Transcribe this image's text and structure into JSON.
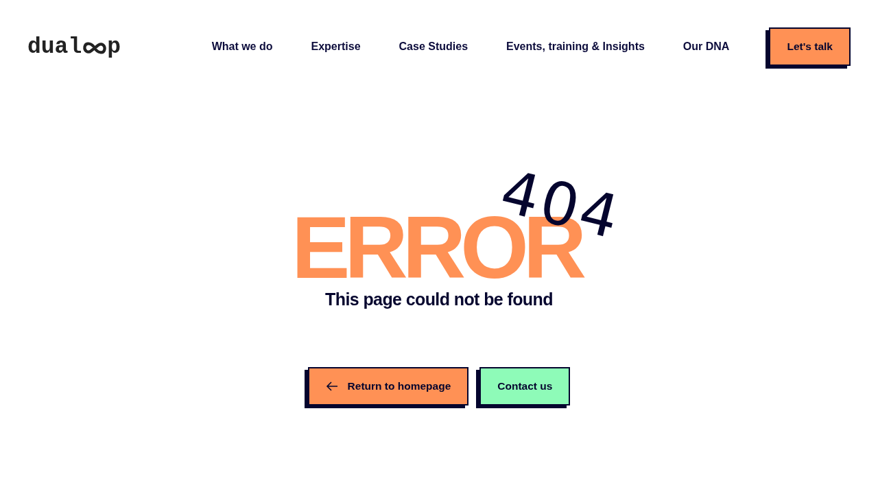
{
  "header": {
    "logo_left": "dual",
    "logo_right": "p",
    "nav": [
      "What we do",
      "Expertise",
      "Case Studies",
      "Events, training & Insights",
      "Our DNA"
    ],
    "cta": "Let's talk"
  },
  "error": {
    "title": "ERROR",
    "code": "404",
    "message": "This page could not be found"
  },
  "actions": [
    {
      "label": "Return to homepage",
      "kind": "back"
    },
    {
      "label": "Contact us",
      "kind": "contact"
    }
  ]
}
